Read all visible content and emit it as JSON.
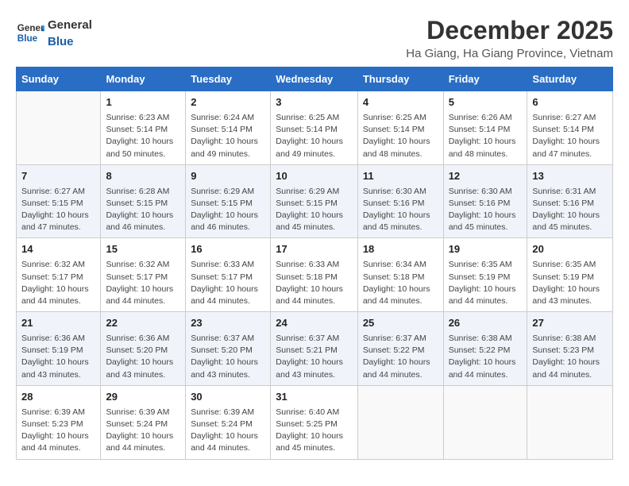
{
  "header": {
    "logo_general": "General",
    "logo_blue": "Blue",
    "month": "December 2025",
    "location": "Ha Giang, Ha Giang Province, Vietnam"
  },
  "weekdays": [
    "Sunday",
    "Monday",
    "Tuesday",
    "Wednesday",
    "Thursday",
    "Friday",
    "Saturday"
  ],
  "weeks": [
    [
      {
        "day": "",
        "info": ""
      },
      {
        "day": "1",
        "info": "Sunrise: 6:23 AM\nSunset: 5:14 PM\nDaylight: 10 hours\nand 50 minutes."
      },
      {
        "day": "2",
        "info": "Sunrise: 6:24 AM\nSunset: 5:14 PM\nDaylight: 10 hours\nand 49 minutes."
      },
      {
        "day": "3",
        "info": "Sunrise: 6:25 AM\nSunset: 5:14 PM\nDaylight: 10 hours\nand 49 minutes."
      },
      {
        "day": "4",
        "info": "Sunrise: 6:25 AM\nSunset: 5:14 PM\nDaylight: 10 hours\nand 48 minutes."
      },
      {
        "day": "5",
        "info": "Sunrise: 6:26 AM\nSunset: 5:14 PM\nDaylight: 10 hours\nand 48 minutes."
      },
      {
        "day": "6",
        "info": "Sunrise: 6:27 AM\nSunset: 5:14 PM\nDaylight: 10 hours\nand 47 minutes."
      }
    ],
    [
      {
        "day": "7",
        "info": "Sunrise: 6:27 AM\nSunset: 5:15 PM\nDaylight: 10 hours\nand 47 minutes."
      },
      {
        "day": "8",
        "info": "Sunrise: 6:28 AM\nSunset: 5:15 PM\nDaylight: 10 hours\nand 46 minutes."
      },
      {
        "day": "9",
        "info": "Sunrise: 6:29 AM\nSunset: 5:15 PM\nDaylight: 10 hours\nand 46 minutes."
      },
      {
        "day": "10",
        "info": "Sunrise: 6:29 AM\nSunset: 5:15 PM\nDaylight: 10 hours\nand 45 minutes."
      },
      {
        "day": "11",
        "info": "Sunrise: 6:30 AM\nSunset: 5:16 PM\nDaylight: 10 hours\nand 45 minutes."
      },
      {
        "day": "12",
        "info": "Sunrise: 6:30 AM\nSunset: 5:16 PM\nDaylight: 10 hours\nand 45 minutes."
      },
      {
        "day": "13",
        "info": "Sunrise: 6:31 AM\nSunset: 5:16 PM\nDaylight: 10 hours\nand 45 minutes."
      }
    ],
    [
      {
        "day": "14",
        "info": "Sunrise: 6:32 AM\nSunset: 5:17 PM\nDaylight: 10 hours\nand 44 minutes."
      },
      {
        "day": "15",
        "info": "Sunrise: 6:32 AM\nSunset: 5:17 PM\nDaylight: 10 hours\nand 44 minutes."
      },
      {
        "day": "16",
        "info": "Sunrise: 6:33 AM\nSunset: 5:17 PM\nDaylight: 10 hours\nand 44 minutes."
      },
      {
        "day": "17",
        "info": "Sunrise: 6:33 AM\nSunset: 5:18 PM\nDaylight: 10 hours\nand 44 minutes."
      },
      {
        "day": "18",
        "info": "Sunrise: 6:34 AM\nSunset: 5:18 PM\nDaylight: 10 hours\nand 44 minutes."
      },
      {
        "day": "19",
        "info": "Sunrise: 6:35 AM\nSunset: 5:19 PM\nDaylight: 10 hours\nand 44 minutes."
      },
      {
        "day": "20",
        "info": "Sunrise: 6:35 AM\nSunset: 5:19 PM\nDaylight: 10 hours\nand 43 minutes."
      }
    ],
    [
      {
        "day": "21",
        "info": "Sunrise: 6:36 AM\nSunset: 5:19 PM\nDaylight: 10 hours\nand 43 minutes."
      },
      {
        "day": "22",
        "info": "Sunrise: 6:36 AM\nSunset: 5:20 PM\nDaylight: 10 hours\nand 43 minutes."
      },
      {
        "day": "23",
        "info": "Sunrise: 6:37 AM\nSunset: 5:20 PM\nDaylight: 10 hours\nand 43 minutes."
      },
      {
        "day": "24",
        "info": "Sunrise: 6:37 AM\nSunset: 5:21 PM\nDaylight: 10 hours\nand 43 minutes."
      },
      {
        "day": "25",
        "info": "Sunrise: 6:37 AM\nSunset: 5:22 PM\nDaylight: 10 hours\nand 44 minutes."
      },
      {
        "day": "26",
        "info": "Sunrise: 6:38 AM\nSunset: 5:22 PM\nDaylight: 10 hours\nand 44 minutes."
      },
      {
        "day": "27",
        "info": "Sunrise: 6:38 AM\nSunset: 5:23 PM\nDaylight: 10 hours\nand 44 minutes."
      }
    ],
    [
      {
        "day": "28",
        "info": "Sunrise: 6:39 AM\nSunset: 5:23 PM\nDaylight: 10 hours\nand 44 minutes."
      },
      {
        "day": "29",
        "info": "Sunrise: 6:39 AM\nSunset: 5:24 PM\nDaylight: 10 hours\nand 44 minutes."
      },
      {
        "day": "30",
        "info": "Sunrise: 6:39 AM\nSunset: 5:24 PM\nDaylight: 10 hours\nand 44 minutes."
      },
      {
        "day": "31",
        "info": "Sunrise: 6:40 AM\nSunset: 5:25 PM\nDaylight: 10 hours\nand 45 minutes."
      },
      {
        "day": "",
        "info": ""
      },
      {
        "day": "",
        "info": ""
      },
      {
        "day": "",
        "info": ""
      }
    ]
  ]
}
